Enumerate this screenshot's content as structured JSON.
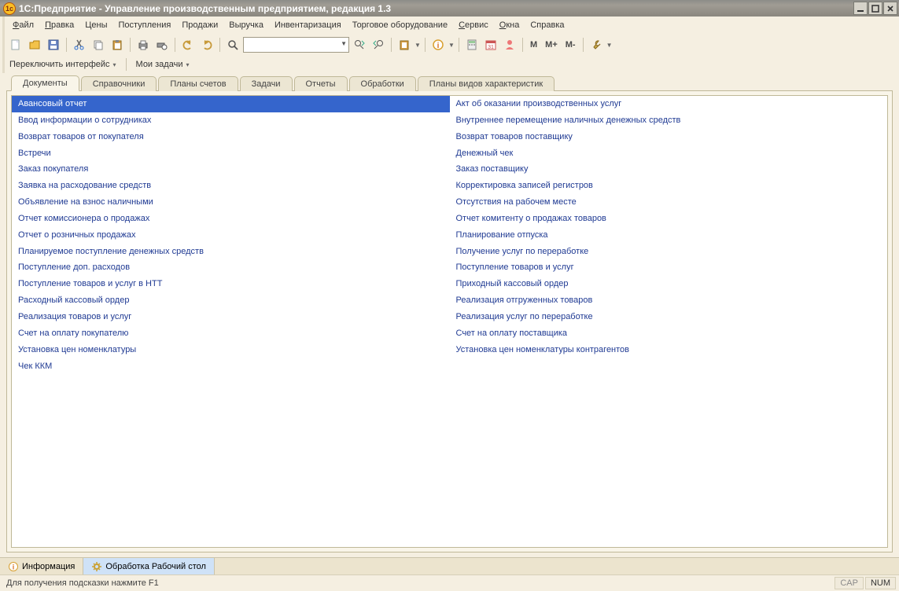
{
  "title": "1С:Предприятие - Управление производственным предприятием, редакция 1.3",
  "menu": [
    "Файл",
    "Правка",
    "Цены",
    "Поступления",
    "Продажи",
    "Выручка",
    "Инвентаризация",
    "Торговое оборудование",
    "Сервис",
    "Окна",
    "Справка"
  ],
  "menu_hotkeys": [
    0,
    0,
    null,
    null,
    null,
    null,
    null,
    null,
    0,
    0,
    null
  ],
  "sub_toolbar": {
    "switch_interface": "Переключить интерфейс",
    "my_tasks": "Мои задачи"
  },
  "toolbar": {
    "m": "M",
    "m_plus": "M+",
    "m_minus": "M-"
  },
  "tabs": [
    "Документы",
    "Справочники",
    "Планы счетов",
    "Задачи",
    "Отчеты",
    "Обработки",
    "Планы видов характеристик"
  ],
  "active_tab": 0,
  "docs_left": [
    "Авансовый отчет",
    "Ввод информации о сотрудниках",
    "Возврат товаров от покупателя",
    "Встречи",
    "Заказ покупателя",
    "Заявка на расходование средств",
    "Объявление на взнос наличными",
    "Отчет комиссионера о продажах",
    "Отчет о розничных продажах",
    "Планируемое поступление денежных средств",
    "Поступление доп. расходов",
    "Поступление товаров и услуг в НТТ",
    "Расходный кассовый ордер",
    "Реализация товаров и услуг",
    "Счет на оплату покупателю",
    "Установка цен номенклатуры",
    "Чек ККМ"
  ],
  "docs_right": [
    "Акт об оказании производственных услуг",
    "Внутреннее перемещение наличных денежных средств",
    "Возврат товаров поставщику",
    "Денежный чек",
    "Заказ поставщику",
    "Корректировка записей регистров",
    "Отсутствия на рабочем месте",
    "Отчет комитенту о продажах товаров",
    "Планирование отпуска",
    "Получение услуг по переработке",
    "Поступление товаров и услуг",
    "Приходный кассовый ордер",
    "Реализация отгруженных товаров",
    "Реализация услуг по переработке",
    "Счет на оплату поставщика",
    "Установка цен номенклатуры контрагентов"
  ],
  "selected_doc": 0,
  "taskbar": {
    "info": "Информация",
    "workdesk": "Обработка  Рабочий стол"
  },
  "statusbar": {
    "hint": "Для получения подсказки нажмите F1",
    "cap": "CAP",
    "num": "NUM"
  }
}
